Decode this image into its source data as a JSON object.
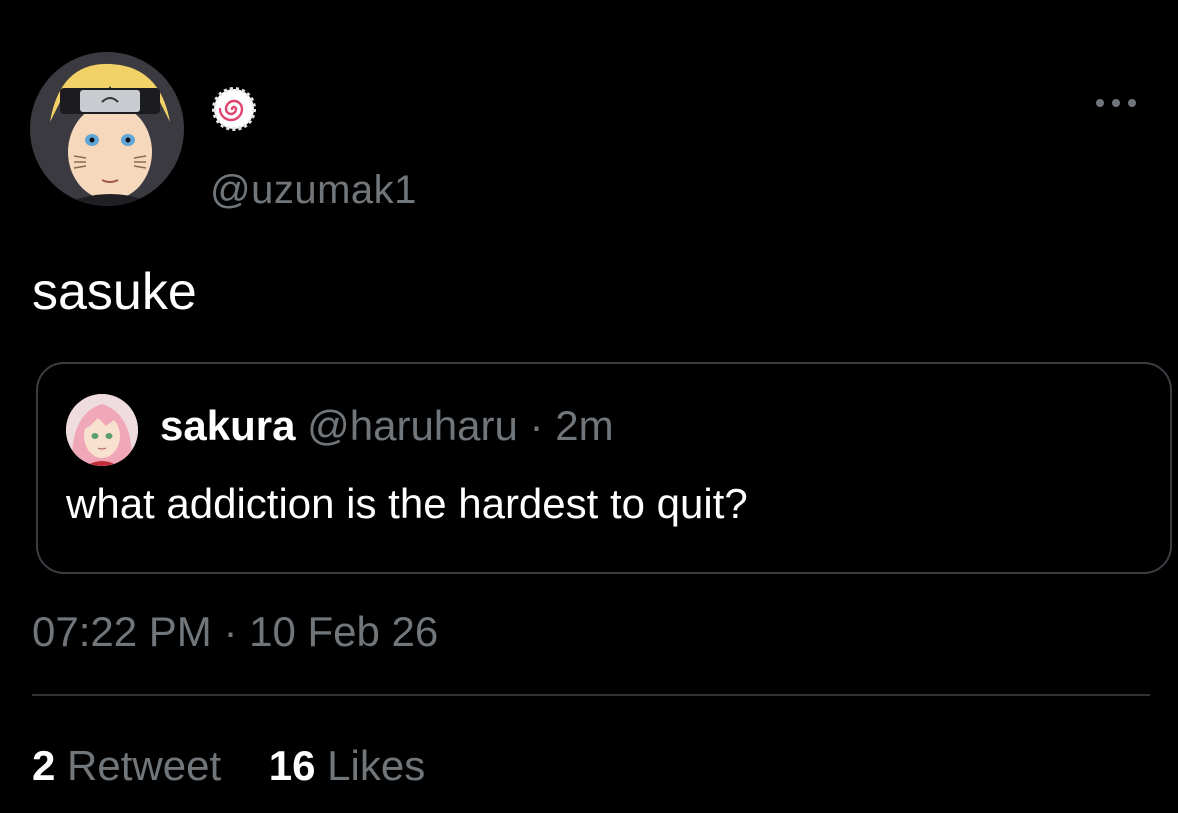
{
  "author": {
    "handle": "@uzumak1",
    "avatar_icon": "naruto-avatar",
    "badge_icon": "naruto-swirl-badge-icon"
  },
  "tweet": {
    "text": "sasuke",
    "timestamp": "07:22 PM",
    "separator": "·",
    "date": "10 Feb 26"
  },
  "quote": {
    "display_name": "sakura",
    "handle": "@haruharu",
    "separator": "·",
    "age": "2m",
    "text": "what addiction is the hardest to quit?",
    "avatar_icon": "sakura-avatar"
  },
  "stats": {
    "retweets_count": "2",
    "retweets_label": "Retweet",
    "likes_count": "16",
    "likes_label": "Likes"
  },
  "colors": {
    "background": "#000000",
    "text": "#ffffff",
    "muted": "#71767b",
    "border": "#3a3d42"
  }
}
